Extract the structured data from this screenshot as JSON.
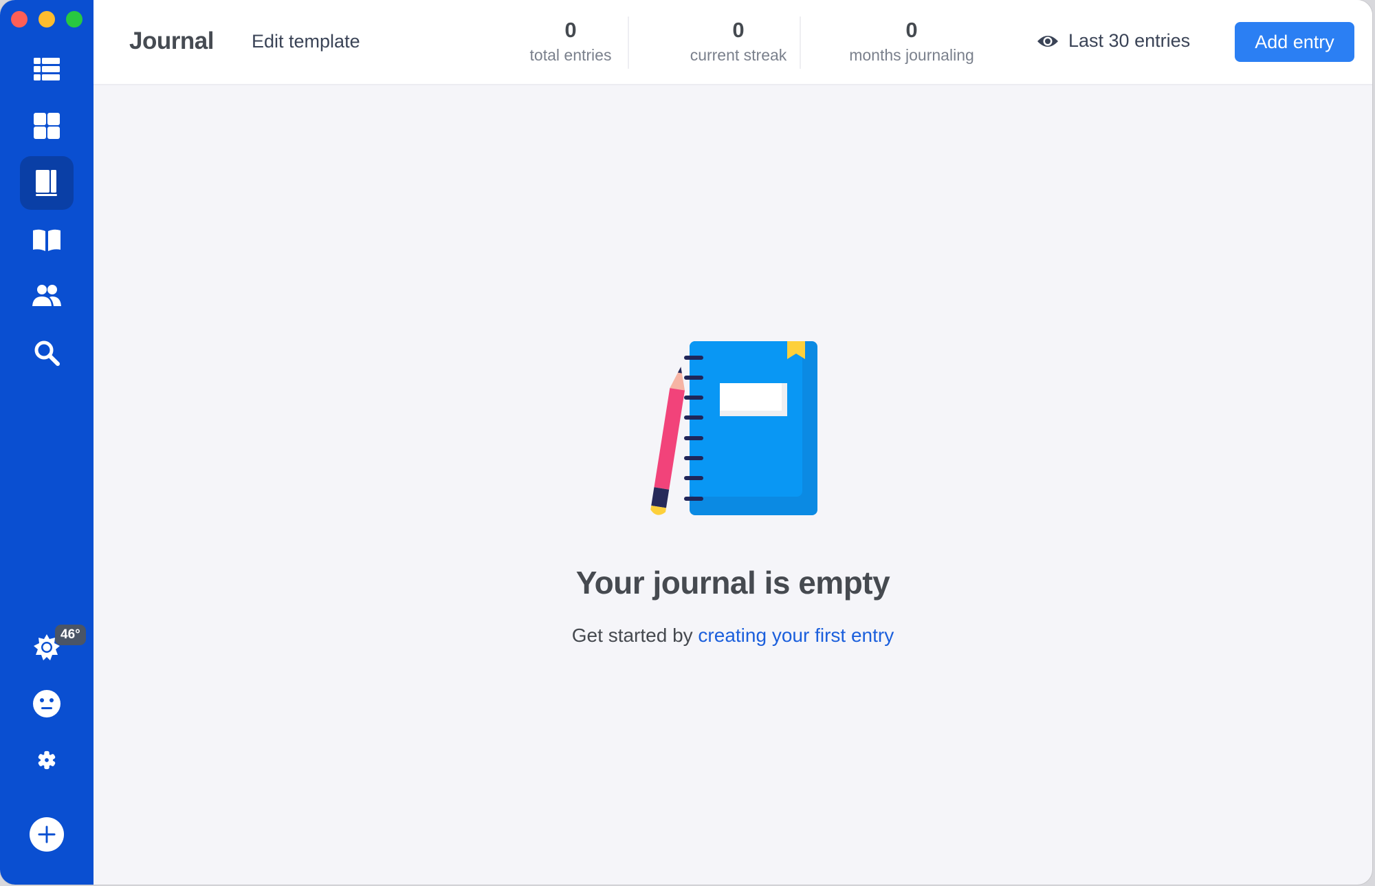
{
  "window": {
    "traffic_lights": [
      "close",
      "minimize",
      "zoom"
    ]
  },
  "sidebar": {
    "items": [
      {
        "name": "list-view",
        "icon": "list-icon"
      },
      {
        "name": "grid-view",
        "icon": "grid-icon"
      },
      {
        "name": "journal",
        "icon": "journal-book-icon",
        "active": true
      },
      {
        "name": "library",
        "icon": "open-book-icon"
      },
      {
        "name": "people",
        "icon": "people-icon"
      },
      {
        "name": "search",
        "icon": "search-icon"
      }
    ],
    "bottom_items": [
      {
        "name": "weather",
        "icon": "sun-icon",
        "badge": "46°"
      },
      {
        "name": "mood",
        "icon": "neutral-face-icon"
      },
      {
        "name": "settings",
        "icon": "gear-icon"
      },
      {
        "name": "add",
        "icon": "plus-circle-icon"
      }
    ]
  },
  "header": {
    "title": "Journal",
    "edit_template": "Edit template",
    "stats": [
      {
        "value": "0",
        "label": "total entries"
      },
      {
        "value": "0",
        "label": "current streak"
      },
      {
        "value": "0",
        "label": "months journaling"
      }
    ],
    "filter_label": "Last 30 entries",
    "filter_icon": "eye-icon",
    "add_entry": "Add entry"
  },
  "empty_state": {
    "illustration": "notebook-and-pencil",
    "title": "Your journal is empty",
    "subtitle_prefix": "Get started by ",
    "subtitle_link": "creating your first entry"
  },
  "colors": {
    "sidebar": "#0a4fd1",
    "sidebar_active": "#0a3fa6",
    "accent_button": "#2b7ff3",
    "link": "#1b5fdc",
    "background": "#f5f5f9"
  }
}
